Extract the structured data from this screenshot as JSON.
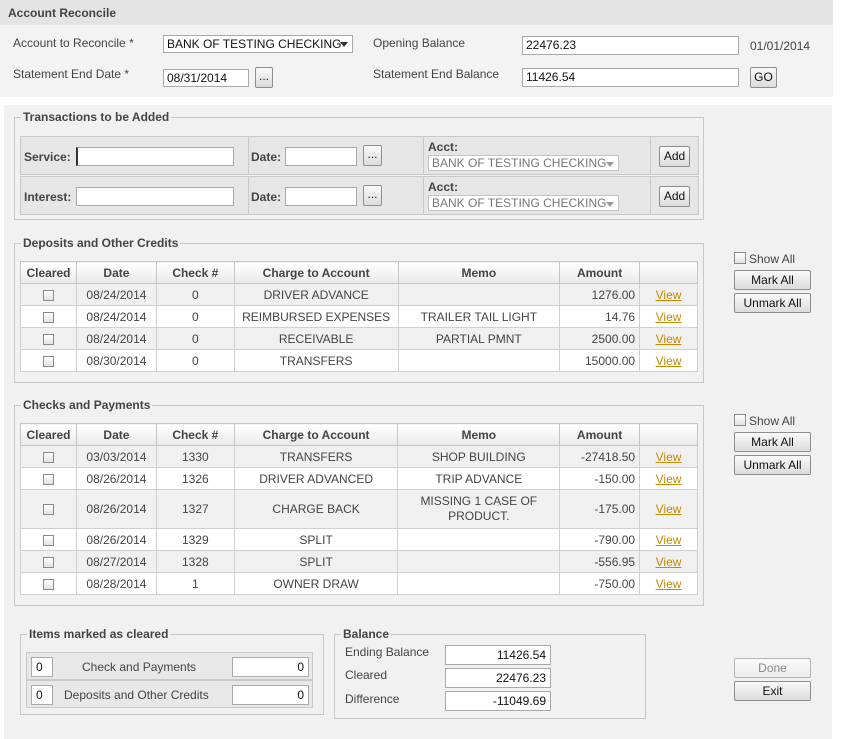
{
  "header": {
    "title": "Account Reconcile",
    "account_label": "Account to Reconcile *",
    "account_value": "BANK OF TESTING CHECKING",
    "statement_end_date_label": "Statement End Date *",
    "statement_end_date_value": "08/31/2014",
    "date_picker_label": "...",
    "opening_balance_label": "Opening Balance",
    "opening_balance_value": "22476.23",
    "opening_balance_date": "01/01/2014",
    "statement_end_balance_label": "Statement End Balance",
    "statement_end_balance_value": "11426.54",
    "go_label": "GO"
  },
  "transactions_to_add": {
    "legend": "Transactions to be Added",
    "rows": [
      {
        "type_label": "Service:",
        "type_value": "",
        "date_label": "Date:",
        "date_value": "",
        "picker": "...",
        "acct_label": "Acct:",
        "acct_value": "BANK OF TESTING CHECKING",
        "add_label": "Add"
      },
      {
        "type_label": "Interest:",
        "type_value": "",
        "date_label": "Date:",
        "date_value": "",
        "picker": "...",
        "acct_label": "Acct:",
        "acct_value": "BANK OF TESTING CHECKING",
        "add_label": "Add"
      }
    ]
  },
  "columns": [
    "Cleared",
    "Date",
    "Check #",
    "Charge to Account",
    "Memo",
    "Amount",
    ""
  ],
  "deposits": {
    "legend": "Deposits and Other Credits",
    "show_all_label": "Show All",
    "mark_all_label": "Mark All",
    "unmark_all_label": "Unmark All",
    "rows": [
      {
        "date": "08/24/2014",
        "check": "0",
        "account": "DRIVER ADVANCE",
        "memo": "",
        "amount": "1276.00",
        "link": "View"
      },
      {
        "date": "08/24/2014",
        "check": "0",
        "account": "REIMBURSED EXPENSES",
        "memo": "TRAILER TAIL LIGHT",
        "amount": "14.76",
        "link": "View"
      },
      {
        "date": "08/24/2014",
        "check": "0",
        "account": "RECEIVABLE",
        "memo": "PARTIAL PMNT",
        "amount": "2500.00",
        "link": "View"
      },
      {
        "date": "08/30/2014",
        "check": "0",
        "account": "TRANSFERS",
        "memo": "",
        "amount": "15000.00",
        "link": "View"
      }
    ]
  },
  "checks": {
    "legend": "Checks and Payments",
    "show_all_label": "Show All",
    "mark_all_label": "Mark All",
    "unmark_all_label": "Unmark All",
    "rows": [
      {
        "date": "03/03/2014",
        "check": "1330",
        "account": "TRANSFERS",
        "memo": "SHOP BUILDING",
        "memo2": "",
        "amount": "-27418.50",
        "link": "View"
      },
      {
        "date": "08/26/2014",
        "check": "1326",
        "account": "DRIVER ADVANCED",
        "memo": "TRIP ADVANCE",
        "memo2": "",
        "amount": "-150.00",
        "link": "View"
      },
      {
        "date": "08/26/2014",
        "check": "1327",
        "account": "CHARGE BACK",
        "memo": "MISSING 1 CASE OF",
        "memo2": "PRODUCT.",
        "amount": "-175.00",
        "link": "View"
      },
      {
        "date": "08/26/2014",
        "check": "1329",
        "account": "SPLIT",
        "memo": "",
        "memo2": "",
        "amount": "-790.00",
        "link": "View"
      },
      {
        "date": "08/27/2014",
        "check": "1328",
        "account": "SPLIT",
        "memo": "",
        "memo2": "",
        "amount": "-556.95",
        "link": "View"
      },
      {
        "date": "08/28/2014",
        "check": "1",
        "account": "OWNER DRAW",
        "memo": "",
        "memo2": "",
        "amount": "-750.00",
        "link": "View"
      }
    ]
  },
  "cleared_summary": {
    "legend": "Items marked as cleared",
    "rows": [
      {
        "count": "0",
        "label": "Check and Payments",
        "total": "0"
      },
      {
        "count": "0",
        "label": "Deposits and Other Credits",
        "total": "0"
      }
    ]
  },
  "balance": {
    "legend": "Balance",
    "ending_label": "Ending Balance",
    "ending_value": "11426.54",
    "cleared_label": "Cleared",
    "cleared_value": "22476.23",
    "difference_label": "Difference",
    "difference_value": "-11049.69"
  },
  "actions": {
    "done_label": "Done",
    "exit_label": "Exit"
  }
}
